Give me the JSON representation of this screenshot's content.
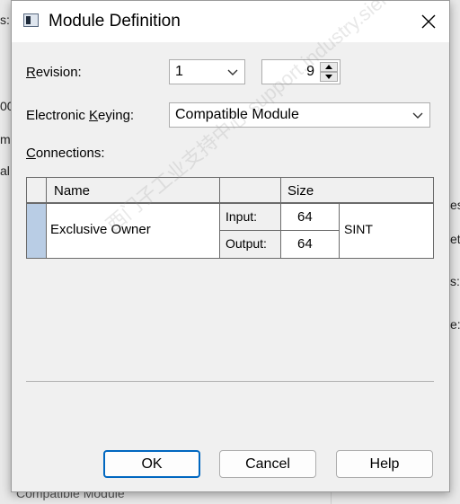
{
  "background_fragments": [
    "s:",
    "00",
    "m",
    "al",
    "es",
    "etv",
    "s:",
    "e:",
    "Compatible Module"
  ],
  "dialog": {
    "title": "Module Definition",
    "close_glyph": "×",
    "revision": {
      "label_accel": "R",
      "label_rest": "evision:",
      "major": "1",
      "minor": "9"
    },
    "keying": {
      "label_pre": "Electronic ",
      "label_accel": "K",
      "label_rest": "eying:",
      "value": "Compatible Module"
    },
    "connections": {
      "label_accel": "C",
      "label_rest": "onnections:",
      "headers": {
        "name": "Name",
        "size": "Size"
      },
      "rows": [
        {
          "name": "Exclusive Owner",
          "input_label": "Input:",
          "input_size": "64",
          "output_label": "Output:",
          "output_size": "64",
          "type": "SINT"
        }
      ]
    },
    "buttons": {
      "ok": "OK",
      "cancel": "Cancel",
      "help": "Help"
    }
  },
  "watermark": "西门子工业支持中心  support.industry.siemens.com/cs",
  "colors": {
    "default_button_border": "#0067c0",
    "row_selector": "#b9cde5"
  }
}
